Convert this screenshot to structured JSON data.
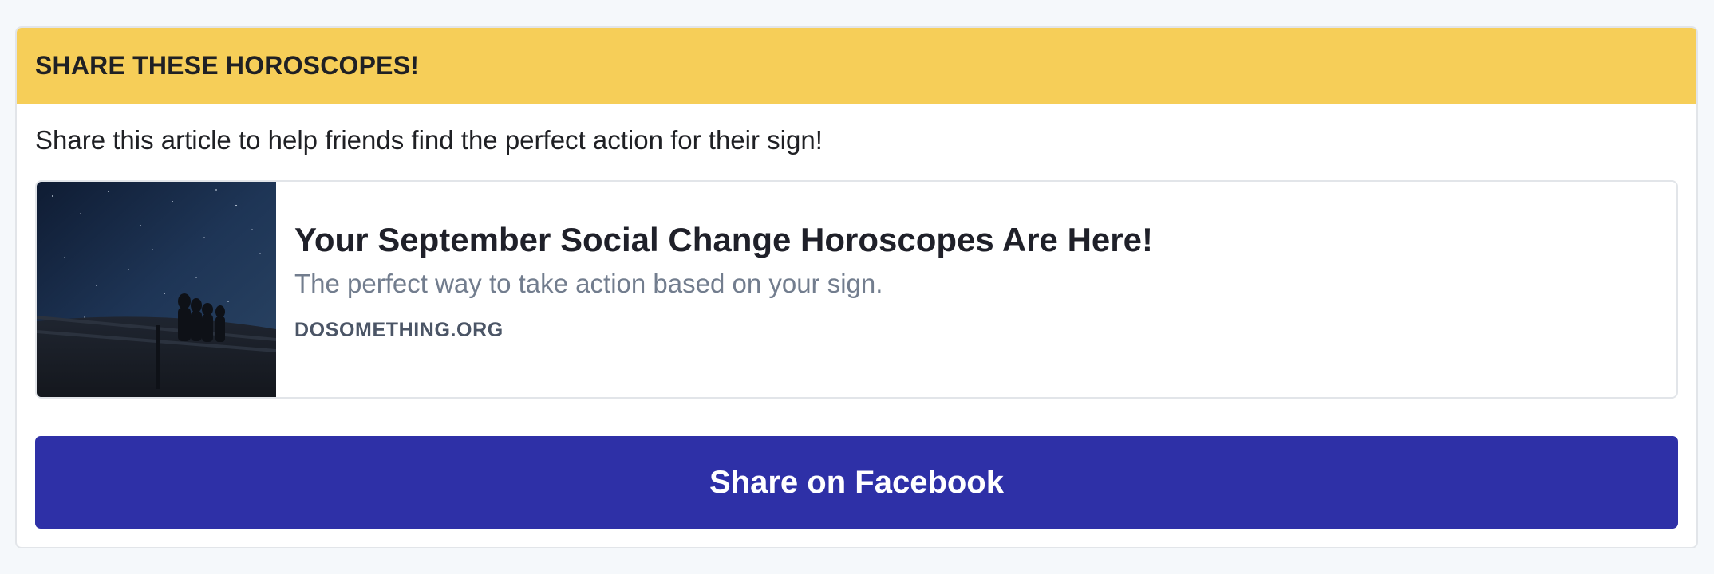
{
  "header": {
    "title": "SHARE THESE HOROSCOPES!"
  },
  "intro": {
    "text": "Share this article to help friends find the perfect action for their sign!"
  },
  "preview": {
    "image_subject": "night-sky-silhouettes",
    "title": "Your September Social Change Horoscopes Are Here!",
    "description": "The perfect way to take action based on your sign.",
    "domain": "DOSOMETHING.ORG"
  },
  "share_button": {
    "label": "Share on Facebook"
  },
  "colors": {
    "header_bg": "#f6ce58",
    "button_bg": "#2e30a7",
    "page_bg": "#f5f8fb"
  }
}
